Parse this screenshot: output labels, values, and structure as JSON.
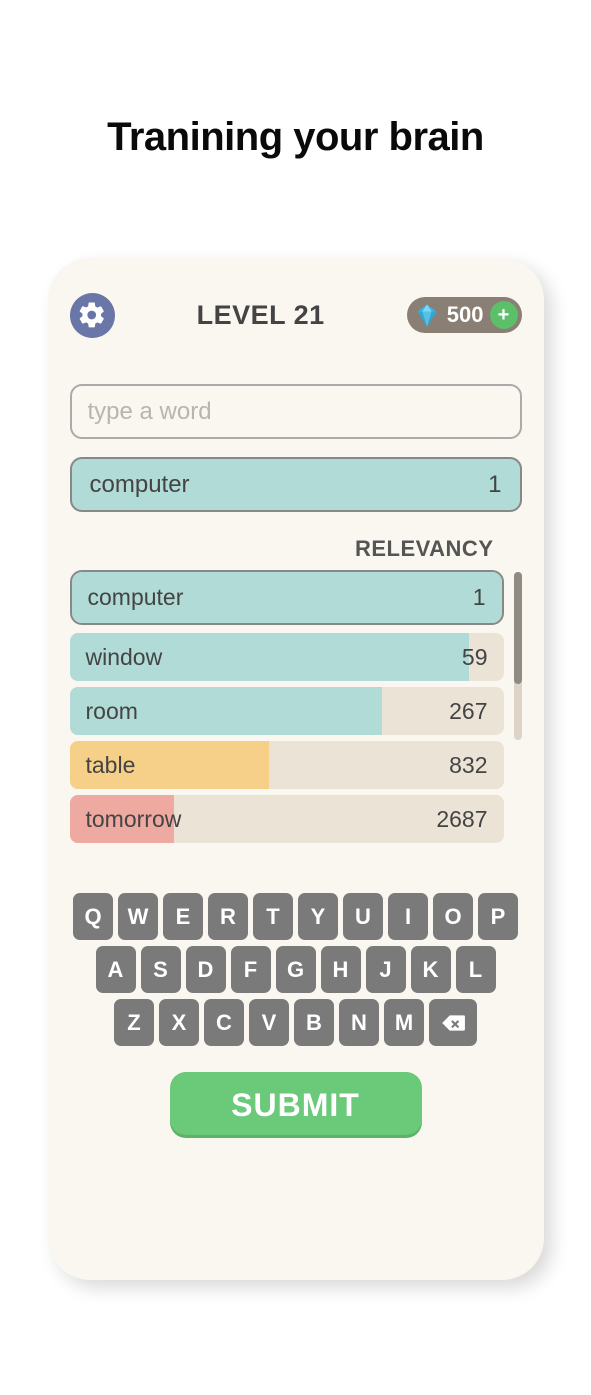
{
  "headline": "Tranining your brain",
  "header": {
    "level_label": "LEVEL 21",
    "gems": "500"
  },
  "input": {
    "placeholder": "type a word"
  },
  "current_guess": {
    "word": "computer",
    "rank": "1"
  },
  "relevancy_label": "RELEVANCY",
  "guesses": [
    {
      "word": "computer",
      "rank": "1",
      "pct": 100,
      "color": "#b0dbd6"
    },
    {
      "word": "window",
      "rank": "59",
      "pct": 92,
      "color": "#b0dbd6"
    },
    {
      "word": "room",
      "rank": "267",
      "pct": 72,
      "color": "#b0dbd6"
    },
    {
      "word": "table",
      "rank": "832",
      "pct": 46,
      "color": "#f6d088"
    },
    {
      "word": "tomorrow",
      "rank": "2687",
      "pct": 24,
      "color": "#eea9a0"
    }
  ],
  "keyboard": {
    "rows": [
      [
        "Q",
        "W",
        "E",
        "R",
        "T",
        "Y",
        "U",
        "I",
        "O",
        "P"
      ],
      [
        "A",
        "S",
        "D",
        "F",
        "G",
        "H",
        "J",
        "K",
        "L"
      ],
      [
        "Z",
        "X",
        "C",
        "V",
        "B",
        "N",
        "M"
      ]
    ]
  },
  "submit_label": "SUBMIT"
}
